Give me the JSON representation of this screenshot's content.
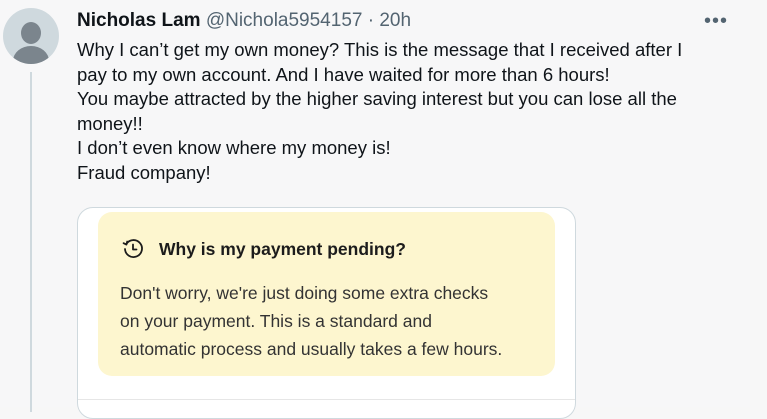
{
  "tweet": {
    "display_name": "Nicholas Lam",
    "handle": "@Nichola5954157",
    "separator": "·",
    "time": "20h",
    "more_label": "•••",
    "text_lines": [
      "Why I can’t get my own money? This is the message that I received after I",
      "pay to my own account. And I have waited for more than 6 hours!",
      "You maybe attracted by the higher saving interest but you can lose all the",
      "money!!",
      "I don’t even know where my money is!",
      "Fraud company!"
    ]
  },
  "media": {
    "notice": {
      "icon": "clock-history-icon",
      "title": "Why is my payment pending?",
      "body_lines": [
        "Don't worry, we're just doing some extra checks",
        "on your payment. This is a standard and",
        "automatic process and usually takes a few hours."
      ]
    }
  },
  "colors": {
    "background": "#f7f7f8",
    "name": "#0f1419",
    "secondary": "#536471",
    "notice_bg": "#fdf6cf",
    "thread_line": "#cfd9de"
  }
}
